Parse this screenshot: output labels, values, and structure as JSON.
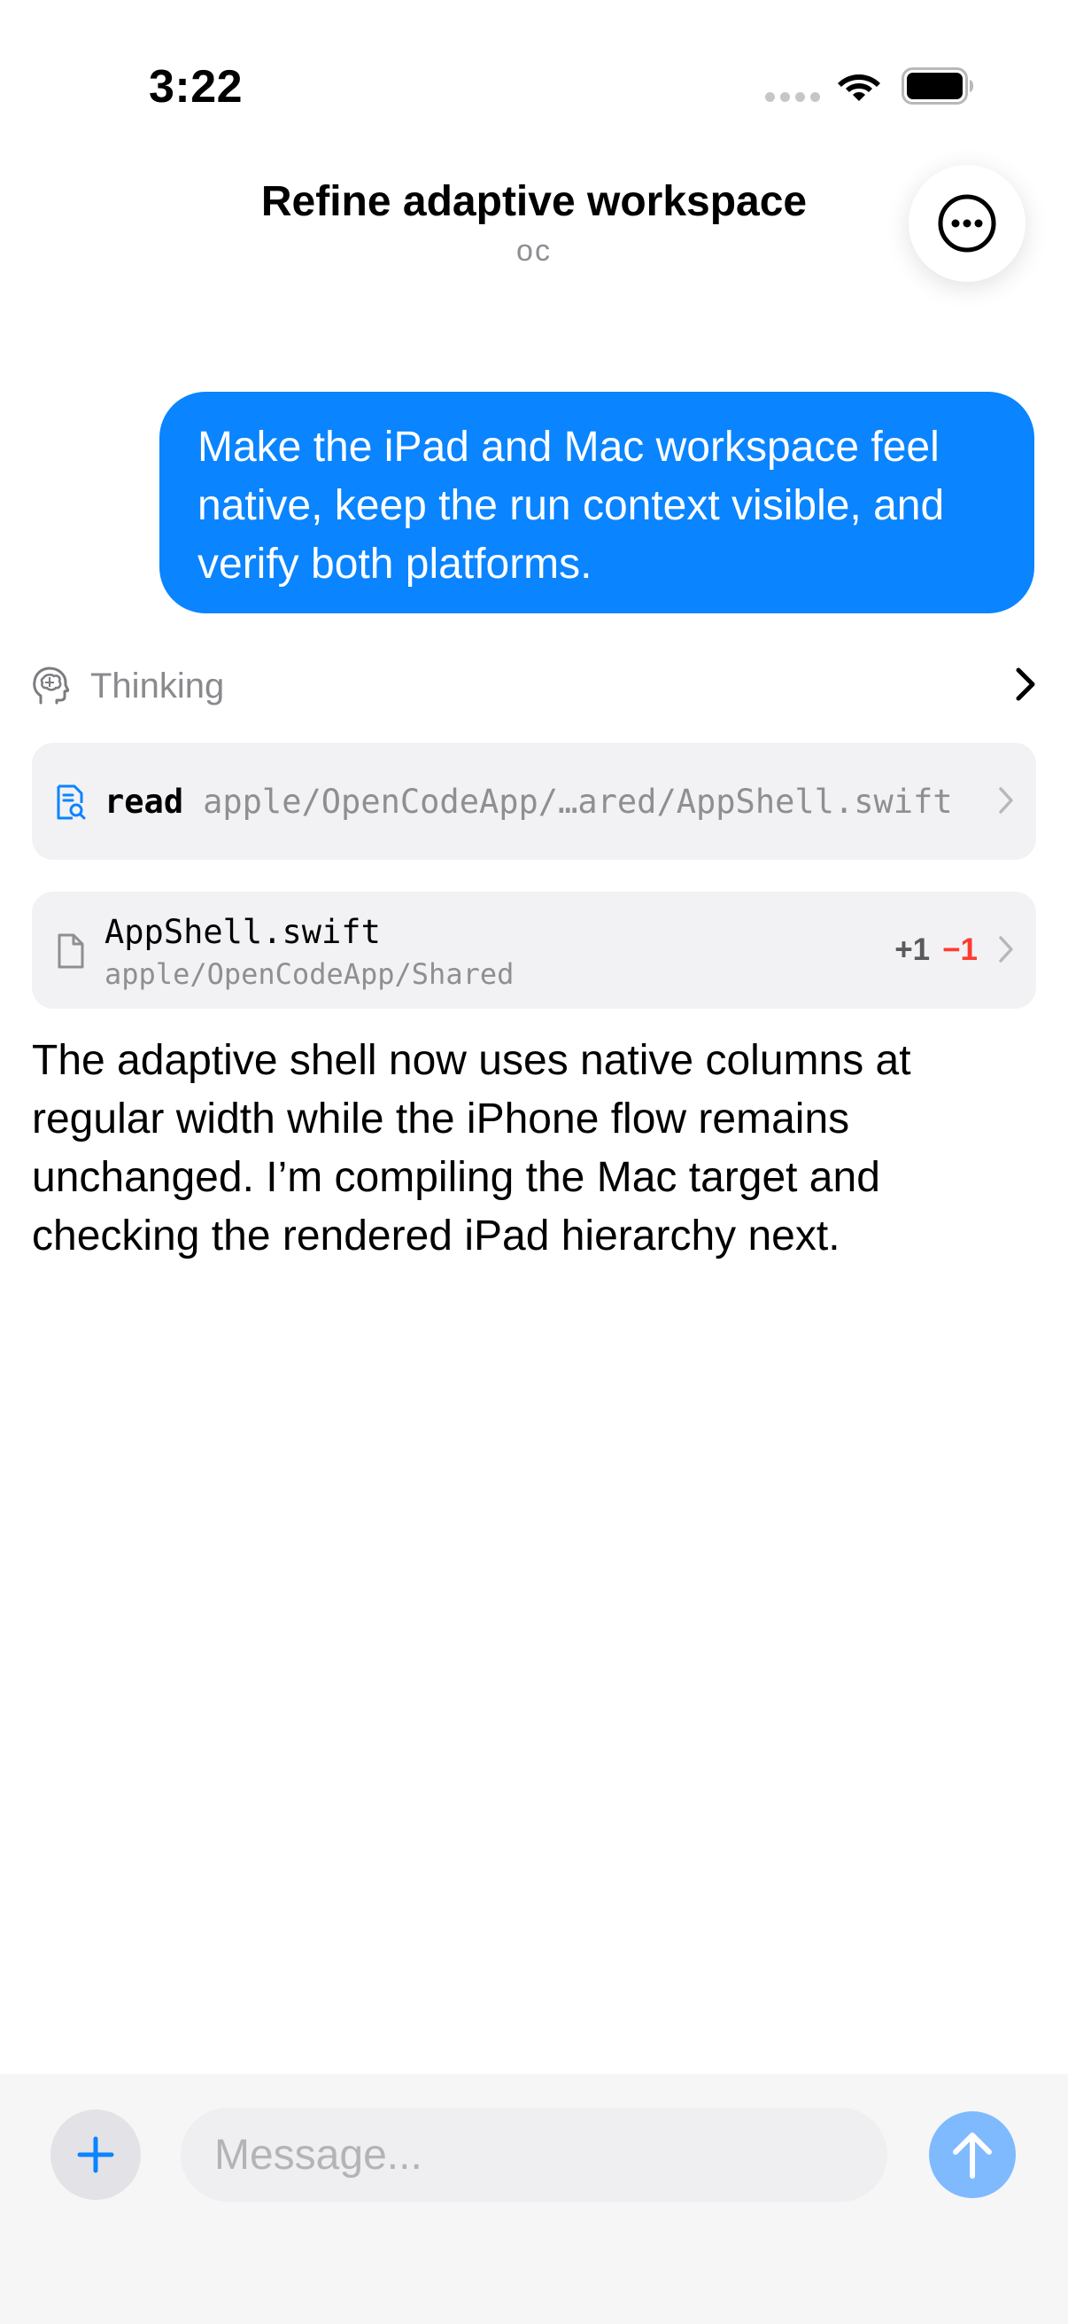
{
  "status_bar": {
    "time": "3:22"
  },
  "header": {
    "title": "Refine adaptive workspace",
    "subtitle": "oc"
  },
  "conversation": {
    "user_message": "Make the iPad and Mac workspace feel native, keep the run context visible, and verify both platforms.",
    "thinking_label": "Thinking",
    "read_tool": {
      "verb": "read",
      "path": "apple/OpenCodeApp/…ared/AppShell.swift"
    },
    "file_change": {
      "name": "AppShell.swift",
      "path": "apple/OpenCodeApp/Shared",
      "additions": "+1",
      "deletions": "−1"
    },
    "assistant_message": "The adaptive shell now uses native columns at regular width while the iPhone flow remains unchanged. I’m compiling the Mac target and checking the rendered iPad hierarchy next."
  },
  "composer": {
    "placeholder": "Message..."
  },
  "colors": {
    "accent": "#0a84ff",
    "send_disabled": "#7fbaff",
    "deletion": "#ff3b30"
  },
  "icons": {
    "more": "ellipsis-circle-icon",
    "thinking": "brain-head-icon",
    "read": "doc-magnifier-icon",
    "file": "doc-icon",
    "add": "plus-icon",
    "send": "arrow-up-icon"
  }
}
